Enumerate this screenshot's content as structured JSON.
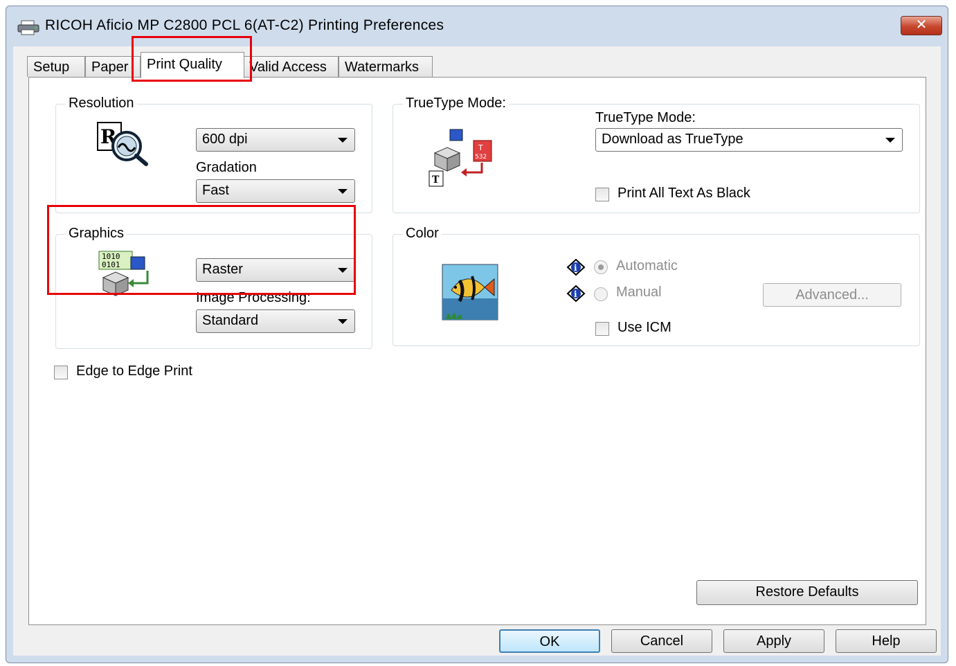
{
  "window": {
    "title": "RICOH Aficio MP C2800 PCL 6(AT-C2) Printing Preferences",
    "close_label": "✕"
  },
  "tabs": [
    {
      "label": "Setup"
    },
    {
      "label": "Paper"
    },
    {
      "label": "Print Quality",
      "active": true
    },
    {
      "label": "Valid Access"
    },
    {
      "label": "Watermarks"
    }
  ],
  "resolution": {
    "group_label": "Resolution",
    "resolution_value": "600 dpi",
    "gradation_label": "Gradation",
    "gradation_value": "Fast"
  },
  "graphics": {
    "group_label": "Graphics",
    "graphics_value": "Raster",
    "image_processing_label": "Image Processing:",
    "image_processing_value": "Standard",
    "icon_text": "1010 0101"
  },
  "truetype": {
    "group_label": "TrueType Mode:",
    "mode_label": "TrueType Mode:",
    "mode_value": "Download as TrueType",
    "print_black_label": "Print All Text As Black",
    "print_black_checked": false
  },
  "color": {
    "group_label": "Color",
    "automatic_label": "Automatic",
    "manual_label": "Manual",
    "selected": "Automatic",
    "advanced_label": "Advanced...",
    "use_icm_label": "Use ICM",
    "use_icm_checked": false
  },
  "edge_to_edge": {
    "label": "Edge to Edge Print",
    "checked": false
  },
  "buttons": {
    "restore_defaults": "Restore Defaults",
    "ok": "OK",
    "cancel": "Cancel",
    "apply": "Apply",
    "help": "Help"
  },
  "colors": {
    "highlight": "#e8000b",
    "titlebar": "#cfdcec",
    "close_button": "#c8472f"
  }
}
